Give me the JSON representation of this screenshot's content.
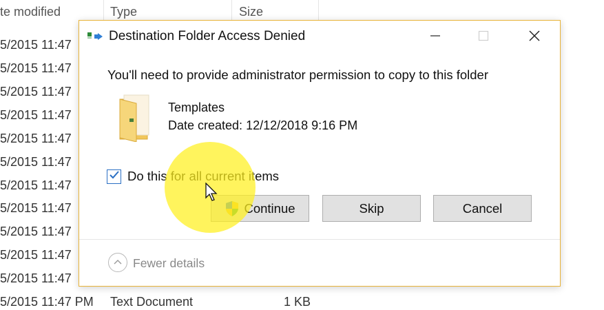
{
  "explorer": {
    "columns": {
      "date": "te modified",
      "type": "Type",
      "size": "Size"
    },
    "rows": [
      {
        "date": "5/2015 11:47"
      },
      {
        "date": "5/2015 11:47"
      },
      {
        "date": "5/2015 11:47"
      },
      {
        "date": "5/2015 11:47"
      },
      {
        "date": "5/2015 11:47"
      },
      {
        "date": "5/2015 11:47"
      },
      {
        "date": "5/2015 11:47"
      },
      {
        "date": "5/2015 11:47"
      },
      {
        "date": "5/2015 11:47"
      },
      {
        "date": "5/2015 11:47"
      },
      {
        "date": "5/2015 11:47"
      }
    ],
    "last_row": {
      "date": "5/2015 11:47 PM",
      "type": "Text Document",
      "size": "1 KB"
    }
  },
  "dialog": {
    "title": "Destination Folder Access Denied",
    "message": "You'll need to provide administrator permission to copy to this folder",
    "item": {
      "name": "Templates",
      "date_created": "Date created: 12/12/2018 9:16 PM"
    },
    "checkbox": {
      "label": "Do this for all current items",
      "checked": true
    },
    "buttons": {
      "continue": "Continue",
      "skip": "Skip",
      "cancel": "Cancel"
    },
    "details_toggle": "Fewer details"
  },
  "colors": {
    "dialog_border": "#e8b338",
    "checkbox_accent": "#2a6fc4",
    "cursor_highlight": "#fff01e",
    "button_bg": "#e1e1e1"
  },
  "icons": [
    "copy-folder-icon",
    "minimize-icon",
    "maximize-icon",
    "close-icon",
    "folder-icon",
    "checkmark-icon",
    "uac-shield-icon",
    "chevron-up-icon",
    "mouse-cursor-icon"
  ]
}
